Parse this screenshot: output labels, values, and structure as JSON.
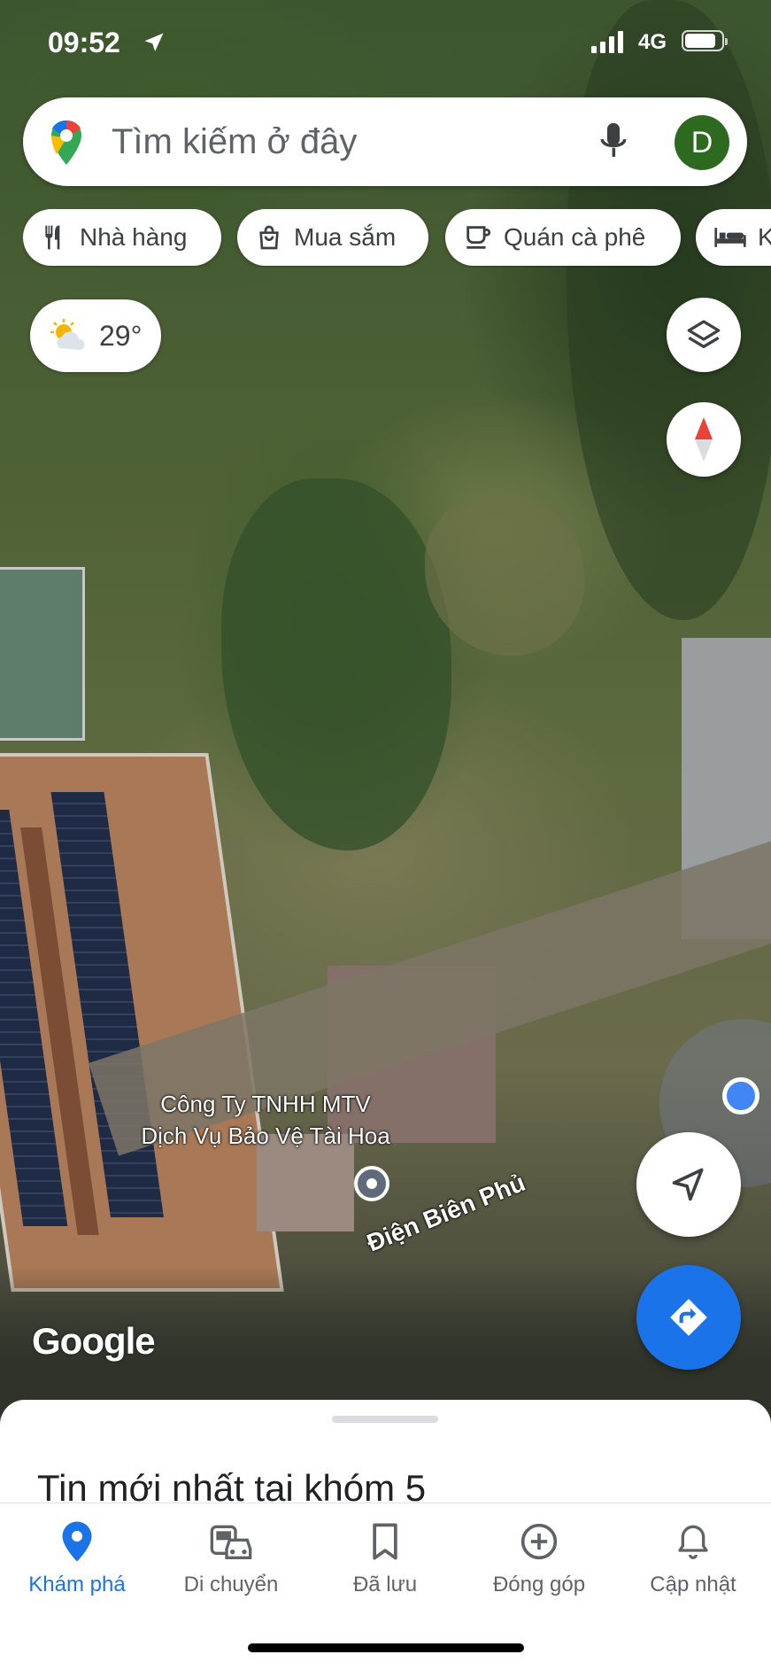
{
  "status_bar": {
    "time": "09:52",
    "network": "4G"
  },
  "search": {
    "placeholder": "Tìm kiếm ở đây",
    "avatar_letter": "D"
  },
  "chips": [
    {
      "label": "Nhà hàng",
      "icon": "restaurant-icon"
    },
    {
      "label": "Mua sắm",
      "icon": "shopping-bag-icon"
    },
    {
      "label": "Quán cà phê",
      "icon": "coffee-icon"
    },
    {
      "label": "K",
      "icon": "hotel-icon"
    }
  ],
  "weather": {
    "temp": "29°",
    "icon": "partly-cloudy-icon"
  },
  "map": {
    "place_label_line1": "Công Ty TNHH MTV",
    "place_label_line2": "Dịch Vụ Bảo Vệ Tài Hoa",
    "street_label": "Điện Biên Phủ",
    "attribution": "Google"
  },
  "sheet": {
    "title": "Tin mới nhất tại khóm 5"
  },
  "tabs": [
    {
      "label": "Khám phá",
      "icon": "explore-pin-icon",
      "active": true
    },
    {
      "label": "Di chuyển",
      "icon": "commute-icon",
      "active": false
    },
    {
      "label": "Đã lưu",
      "icon": "bookmark-icon",
      "active": false
    },
    {
      "label": "Đóng góp",
      "icon": "add-circle-icon",
      "active": false
    },
    {
      "label": "Cập nhật",
      "icon": "bell-icon",
      "active": false
    }
  ],
  "colors": {
    "accent": "#1a73e8",
    "directions_button": "#1a73e8",
    "avatar": "#2d6a1f"
  }
}
